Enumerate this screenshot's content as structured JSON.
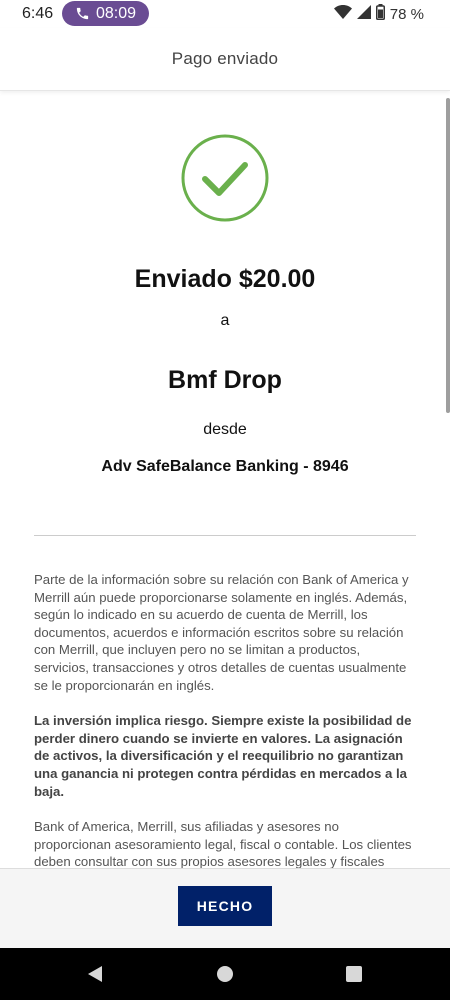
{
  "status_bar": {
    "time": "6:46",
    "call_time": "08:09",
    "battery_percent": "78 %"
  },
  "header": {
    "title": "Pago enviado"
  },
  "confirmation": {
    "sent_amount": "Enviado $20.00",
    "to_word": "a",
    "recipient": "Bmf Drop",
    "from_word": "desde",
    "account": "Adv SafeBalance Banking - 8946"
  },
  "disclosures": [
    "Parte de la información sobre su relación con Bank of America y Merrill aún puede proporcionarse solamente en inglés. Además, según lo indicado en su acuerdo de cuenta de Merrill, los documentos, acuerdos e información escritos sobre su relación con Merrill, que incluyen pero no se limitan a productos, servicios, transacciones y otros detalles de cuentas usualmente se le proporcionarán en inglés.",
    "La inversión implica riesgo. Siempre existe la posibilidad de perder dinero cuando se invierte en valores. La asignación de activos, la diversificación y el reequilibrio no garantizan una ganancia ni protegen contra pérdidas en mercados a la baja.",
    "Bank of America, Merrill, sus afiliadas y asesores no proporcionan asesoramiento legal, fiscal o contable. Los clientes deben consultar con sus propios asesores legales y fiscales"
  ],
  "footer": {
    "done_label": "HECHO"
  },
  "colors": {
    "brand_navy": "#012169",
    "success_green": "#6ab04c",
    "call_chip": "#6a4c93"
  },
  "icons": [
    "phone-icon",
    "wifi-icon",
    "cell-signal-icon",
    "battery-icon",
    "check-circle-icon",
    "back-icon",
    "home-icon",
    "recents-icon"
  ]
}
